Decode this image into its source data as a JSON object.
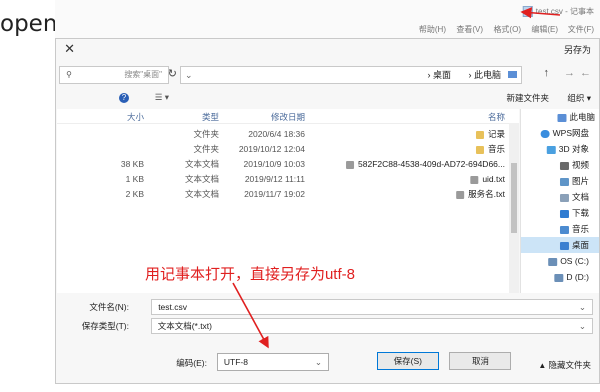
{
  "page_title": "openpyxl保存操作",
  "notepad": {
    "title": "test.csv - 记事本",
    "menu": [
      "文件(F)",
      "编辑(E)",
      "格式(O)",
      "查看(V)",
      "帮助(H)"
    ]
  },
  "dialog": {
    "title": "另存为",
    "close": "✕",
    "nav": {
      "back": "←",
      "forward": "→",
      "up": "↑"
    },
    "address": [
      "此电脑",
      "桌面"
    ],
    "search_placeholder": "搜索\"桌面\"",
    "toolbar": {
      "organize": "组织 ▾",
      "new_folder": "新建文件夹",
      "help": "?"
    },
    "sidebar": [
      {
        "label": "此电脑",
        "icon": "pc-icon",
        "color": "#5b8fd6"
      },
      {
        "label": "WPS网盘",
        "icon": "cloud-icon",
        "color": "#3a8dde"
      },
      {
        "label": "3D 对象",
        "icon": "cube-icon",
        "color": "#4aa0e0"
      },
      {
        "label": "视频",
        "icon": "video-icon",
        "color": "#6a6a6a"
      },
      {
        "label": "图片",
        "icon": "picture-icon",
        "color": "#5f95c8"
      },
      {
        "label": "文档",
        "icon": "document-icon",
        "color": "#8aa0b8"
      },
      {
        "label": "下载",
        "icon": "download-icon",
        "color": "#2f7bd1"
      },
      {
        "label": "音乐",
        "icon": "music-icon",
        "color": "#4c8bd0"
      },
      {
        "label": "桌面",
        "icon": "desktop-icon",
        "color": "#3a7fd0"
      },
      {
        "label": "OS (C:)",
        "icon": "drive-icon",
        "color": "#6b8fb7"
      },
      {
        "label": "D (D:)",
        "icon": "drive-icon",
        "color": "#6b8fb7"
      }
    ],
    "columns": {
      "name": "名称",
      "date": "修改日期",
      "type": "类型",
      "size": "大小"
    },
    "files": [
      {
        "name": "记录",
        "date": "2020/6/4 18:36",
        "type": "文件夹",
        "size": "",
        "icon": "folder-icon",
        "color": "#e8c15a"
      },
      {
        "name": "音乐",
        "date": "2019/10/12 12:04",
        "type": "文件夹",
        "size": "",
        "icon": "folder-icon",
        "color": "#e8c15a"
      },
      {
        "name": "582F2C88-4538-409d-AD72-694D66...",
        "date": "2019/10/9 10:03",
        "type": "文本文档",
        "size": "38 KB",
        "icon": "text-file-icon",
        "color": "#9a9a9a"
      },
      {
        "name": "uid.txt",
        "date": "2019/9/12 11:11",
        "type": "文本文档",
        "size": "1 KB",
        "icon": "text-file-icon",
        "color": "#9a9a9a"
      },
      {
        "name": "服务名.txt",
        "date": "2019/11/7 19:02",
        "type": "文本文档",
        "size": "2 KB",
        "icon": "text-file-icon",
        "color": "#9a9a9a"
      }
    ],
    "filename_label": "文件名(N):",
    "filename_value": "test.csv",
    "filetype_label": "保存类型(T):",
    "filetype_value": "文本文档(*.txt)",
    "hide_folders": "隐藏文件夹",
    "encoding_label": "编码(E):",
    "encoding_value": "UTF-8",
    "save": "保存(S)",
    "cancel": "取消"
  },
  "annotation": "用记事本打开，直接另存为utf-8",
  "accent_color": "#e02020"
}
